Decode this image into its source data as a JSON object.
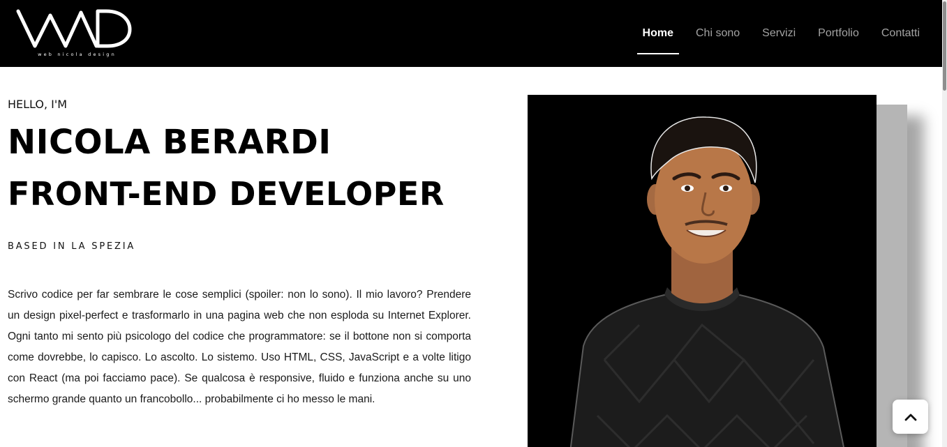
{
  "header": {
    "logo_tagline": "web nicola design",
    "nav": [
      {
        "label": "Home",
        "active": true
      },
      {
        "label": "Chi sono",
        "active": false
      },
      {
        "label": "Servizi",
        "active": false
      },
      {
        "label": "Portfolio",
        "active": false
      },
      {
        "label": "Contatti",
        "active": false
      }
    ]
  },
  "hero": {
    "greeting": "HELLO, I'M",
    "name": "NICOLA BERARDI",
    "role": "FRONT-END DEVELOPER",
    "location": "BASED IN LA SPEZIA",
    "bio": "Scrivo codice per far sembrare le cose semplici (spoiler: non lo sono). Il mio lavoro? Prendere un design pixel-perfect e trasformarlo in una pagina web che non esploda su Internet Explorer. Ogni tanto mi sento più psicologo del codice che programmatore: se il bottone non si comporta come dovrebbe, lo capisco. Lo ascolto. Lo sistemo. Uso HTML, CSS, JavaScript e a volte litigo con React (ma poi facciamo pace). Se qualcosa è responsive, fluido e funziona anche su uno schermo grande quanto un francobollo... probabilmente ci ho messo le mani."
  },
  "colors": {
    "header_bg": "#000000",
    "nav_active": "#ffffff",
    "nav_inactive": "#a3a3a3",
    "page_bg": "#ffffff"
  },
  "icons": {
    "back_to_top": "chevron-up-icon"
  }
}
